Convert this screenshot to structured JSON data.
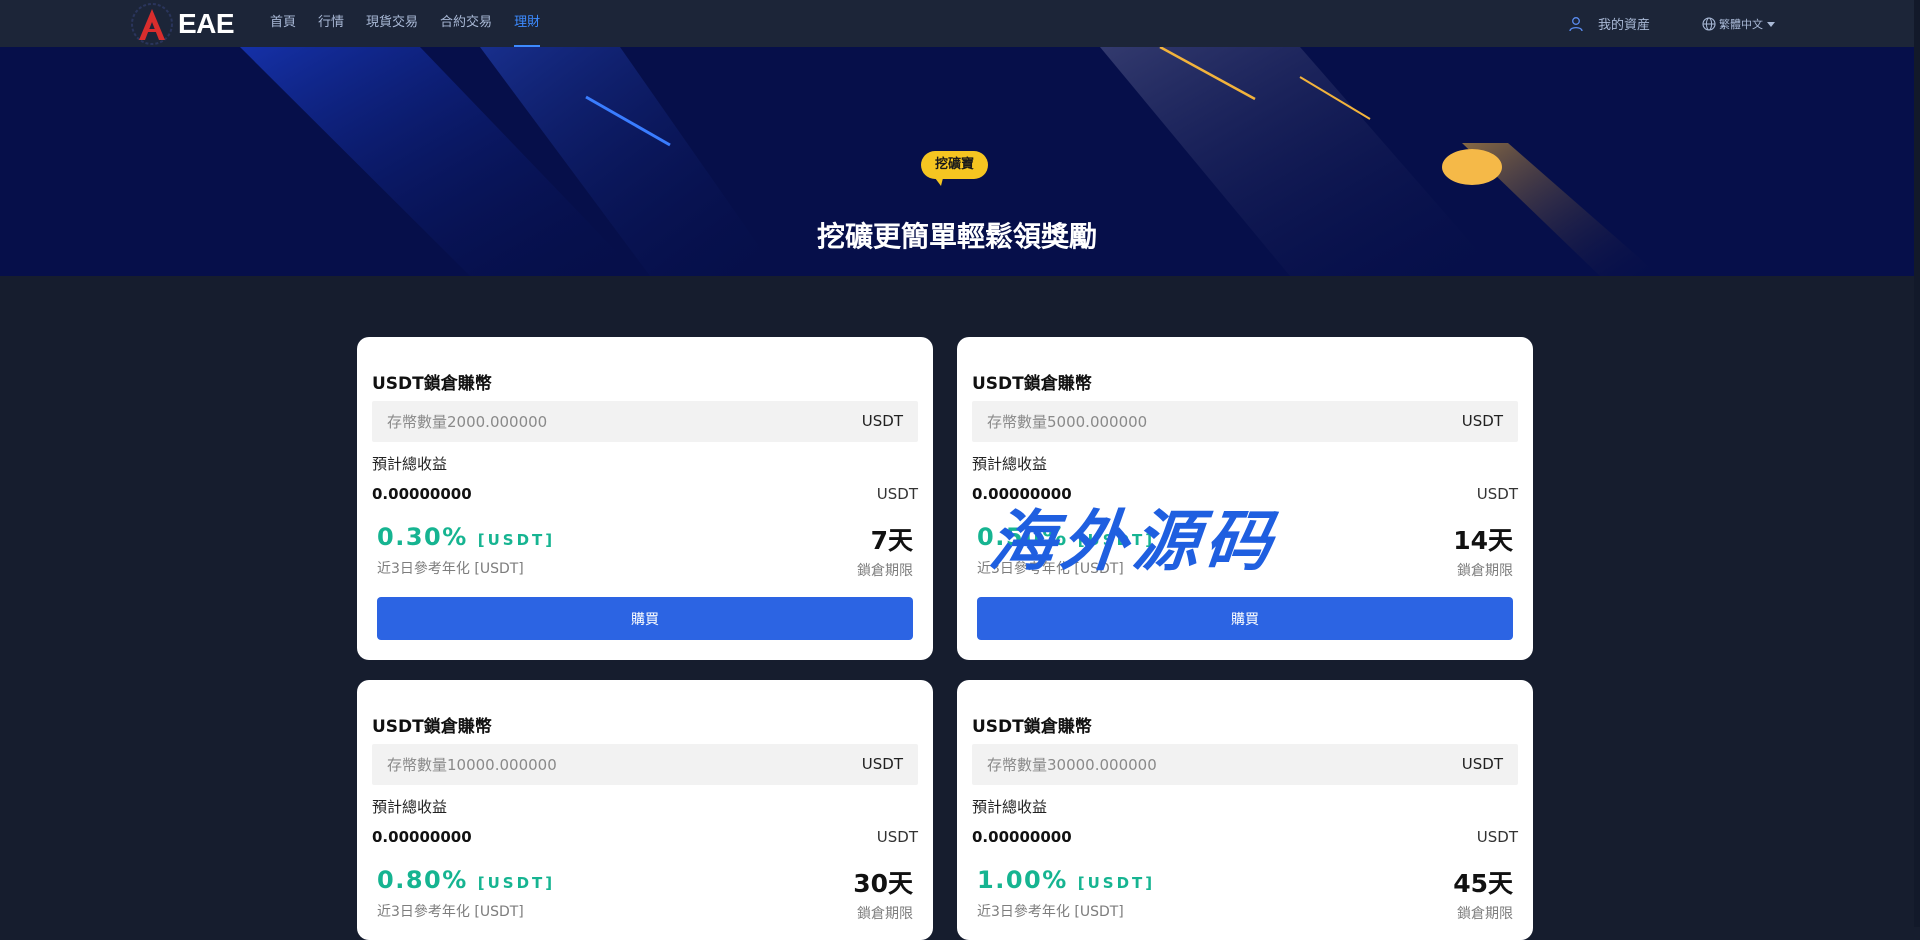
{
  "brand": {
    "logo_text": "EAE",
    "accent": "#d92d2d"
  },
  "nav": {
    "items": [
      "首頁",
      "行情",
      "現貨交易",
      "合約交易",
      "理財"
    ],
    "active_index": 4
  },
  "header": {
    "account_label": "我的資産",
    "language_label": "繁體中文"
  },
  "hero": {
    "badge": "挖礦寶",
    "title": "挖礦更簡單輕鬆領獎勵"
  },
  "cards": [
    {
      "title": "USDT鎖倉賺幣",
      "amount_placeholder": "存幣數量2000.000000",
      "amount_unit": "USDT",
      "estimate_label": "預計總收益",
      "estimate_value": "0.00000000",
      "estimate_unit": "USDT",
      "rate": "0.30%",
      "rate_unit": "[USDT]",
      "rate_label": "近3日參考年化 [USDT]",
      "lock_days": "7天",
      "lock_label": "鎖倉期限",
      "buy_label": "購買"
    },
    {
      "title": "USDT鎖倉賺幣",
      "amount_placeholder": "存幣數量5000.000000",
      "amount_unit": "USDT",
      "estimate_label": "預計總收益",
      "estimate_value": "0.00000000",
      "estimate_unit": "USDT",
      "rate": "0.50%",
      "rate_unit": "[USDT]",
      "rate_label": "近3日參考年化 [USDT]",
      "lock_days": "14天",
      "lock_label": "鎖倉期限",
      "buy_label": "購買"
    },
    {
      "title": "USDT鎖倉賺幣",
      "amount_placeholder": "存幣數量10000.000000",
      "amount_unit": "USDT",
      "estimate_label": "預計總收益",
      "estimate_value": "0.00000000",
      "estimate_unit": "USDT",
      "rate": "0.80%",
      "rate_unit": "[USDT]",
      "rate_label": "近3日參考年化 [USDT]",
      "lock_days": "30天",
      "lock_label": "鎖倉期限",
      "buy_label": "購買"
    },
    {
      "title": "USDT鎖倉賺幣",
      "amount_placeholder": "存幣數量30000.000000",
      "amount_unit": "USDT",
      "estimate_label": "預計總收益",
      "estimate_value": "0.00000000",
      "estimate_unit": "USDT",
      "rate": "1.00%",
      "rate_unit": "[USDT]",
      "rate_label": "近3日參考年化 [USDT]",
      "lock_days": "45天",
      "lock_label": "鎖倉期限",
      "buy_label": "購買"
    }
  ],
  "watermark": "海外源码",
  "icons": {
    "account": "user-icon",
    "language": "globe-icon",
    "language_caret": "caret-down-icon"
  }
}
